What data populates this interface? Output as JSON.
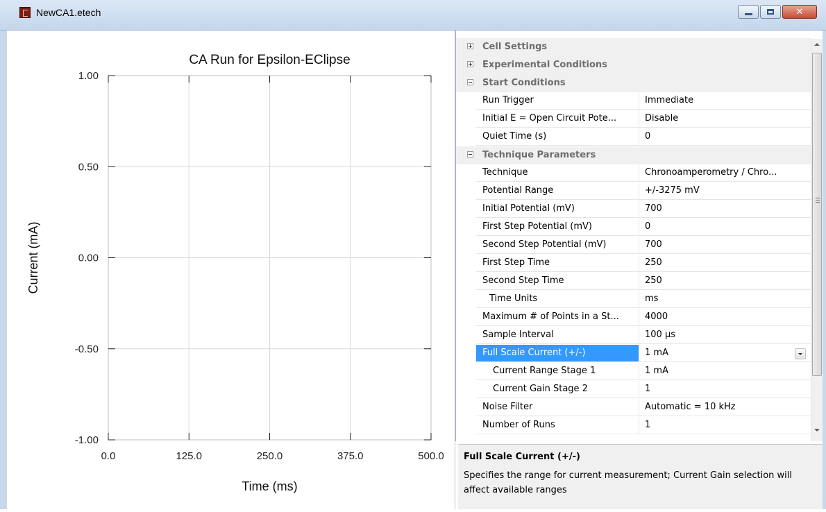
{
  "window": {
    "title": "NewCA1.etech"
  },
  "chart_data": {
    "type": "line",
    "title": "CA Run for Epsilon-EClipse",
    "xlabel": "Time (ms)",
    "ylabel": "Current (mA)",
    "xlim": [
      0,
      500
    ],
    "ylim": [
      -1,
      1
    ],
    "x_ticks": [
      "0.0",
      "125.0",
      "250.0",
      "375.0",
      "500.0"
    ],
    "y_ticks": [
      "1.00",
      "0.50",
      "0.00",
      "-0.50",
      "-1.00"
    ],
    "grid": true,
    "series": []
  },
  "properties": {
    "categories": {
      "cell_settings": "Cell Settings",
      "experimental_conditions": "Experimental Conditions",
      "start_conditions": "Start Conditions",
      "technique_parameters": "Technique Parameters"
    },
    "start_rows": [
      {
        "name": "Run Trigger",
        "value": "Immediate"
      },
      {
        "name": "Initial E = Open Circuit Pote...",
        "value": "Disable"
      },
      {
        "name": "Quiet Time (s)",
        "value": "0"
      }
    ],
    "technique_rows": [
      {
        "name": "Technique",
        "value": "Chronoamperometry / Chro..."
      },
      {
        "name": "Potential Range",
        "value": "+/-3275 mV"
      },
      {
        "name": "Initial Potential (mV)",
        "value": "700"
      },
      {
        "name": "First Step Potential (mV)",
        "value": "0"
      },
      {
        "name": "Second Step Potential (mV)",
        "value": "700"
      },
      {
        "name": "First Step Time",
        "value": "250"
      },
      {
        "name": "Second Step Time",
        "value": "250"
      },
      {
        "name": "Time Units",
        "value": "ms"
      },
      {
        "name": "Maximum # of Points in a St...",
        "value": "4000"
      },
      {
        "name": "Sample Interval",
        "value": "100 µs"
      },
      {
        "name": "Full Scale Current (+/-)",
        "value": "1 mA"
      },
      {
        "name": "Current Range Stage 1",
        "value": "1 mA"
      },
      {
        "name": "Current Gain Stage 2",
        "value": "1"
      },
      {
        "name": "Noise Filter",
        "value": "Automatic = 10 kHz"
      },
      {
        "name": "Number of Runs",
        "value": "1"
      }
    ]
  },
  "description": {
    "title": "Full Scale Current (+/-)",
    "text": "Specifies the range for current measurement; Current Gain selection will affect available ranges"
  },
  "colors": {
    "selection": "#3399ff",
    "category_bg": "#f0f0f0",
    "grid_line": "#d8d8d8"
  },
  "icons": [
    "app-icon",
    "minimize-icon",
    "maximize-icon",
    "close-icon",
    "collapse-icon",
    "expand-icon",
    "dropdown-arrow-icon"
  ]
}
